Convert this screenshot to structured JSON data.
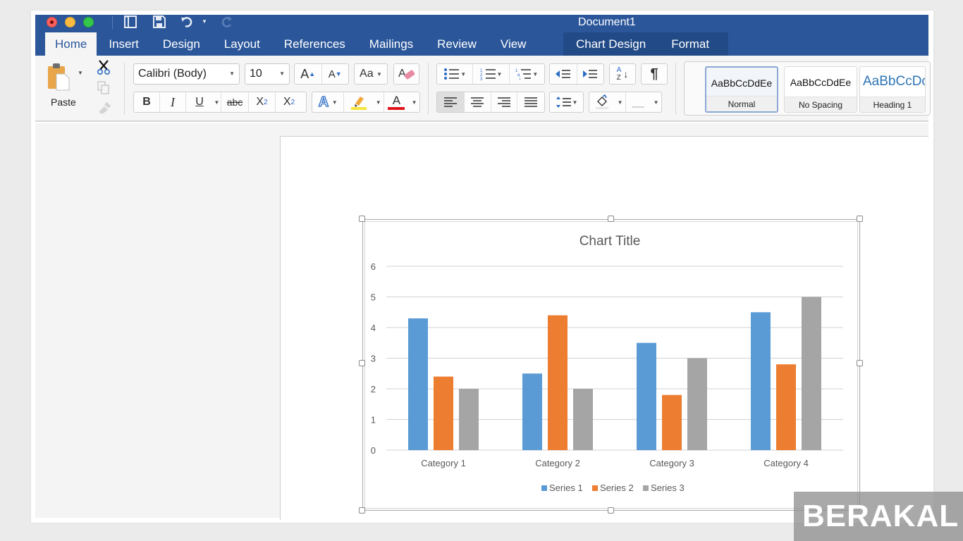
{
  "window": {
    "title": "Document1",
    "quick_access": [
      {
        "icon": "sidebar-icon"
      },
      {
        "icon": "save-icon"
      },
      {
        "icon": "undo-icon"
      },
      {
        "icon": "redo-icon"
      }
    ]
  },
  "tabs": [
    {
      "label": "Home",
      "active": true
    },
    {
      "label": "Insert"
    },
    {
      "label": "Design"
    },
    {
      "label": "Layout"
    },
    {
      "label": "References"
    },
    {
      "label": "Mailings"
    },
    {
      "label": "Review"
    },
    {
      "label": "View"
    }
  ],
  "context_tabs": [
    {
      "label": "Chart Design"
    },
    {
      "label": "Format"
    }
  ],
  "ribbon": {
    "paste_label": "Paste",
    "font_name": "Calibri (Body)",
    "font_size": "10",
    "glyphs": {
      "grow": "A",
      "shrink": "A",
      "change_case": "Aa",
      "bold": "B",
      "italic": "I",
      "underline": "U",
      "strike": "abc",
      "subscript": "X",
      "subscript_sub": "2",
      "superscript": "X",
      "superscript_sup": "2",
      "text_effects": "A",
      "font_color": "A",
      "pilcrow": "¶",
      "sort_a": "A",
      "sort_z": "Z"
    },
    "colors": {
      "highlight": "#f5e53b",
      "font_color": "#e0131b",
      "accent": "#2b579a"
    },
    "styles": [
      {
        "sample": "AaBbCcDdEe",
        "name": "Normal",
        "selected": true
      },
      {
        "sample": "AaBbCcDdEe",
        "name": "No Spacing"
      },
      {
        "sample": "AaBbCcDc",
        "name": "Heading 1"
      }
    ]
  },
  "chart_data": {
    "type": "bar",
    "title": "Chart Title",
    "categories": [
      "Category 1",
      "Category 2",
      "Category 3",
      "Category 4"
    ],
    "series": [
      {
        "name": "Series 1",
        "color": "#5b9bd5",
        "values": [
          4.3,
          2.5,
          3.5,
          4.5
        ]
      },
      {
        "name": "Series 2",
        "color": "#ed7d31",
        "values": [
          2.4,
          4.4,
          1.8,
          2.8
        ]
      },
      {
        "name": "Series 3",
        "color": "#a5a5a5",
        "values": [
          2,
          2,
          3,
          5
        ]
      }
    ],
    "ylim": [
      0,
      6
    ],
    "yticks": [
      "0",
      "1",
      "2",
      "3",
      "4",
      "5",
      "6"
    ],
    "xlabel": "",
    "ylabel": "",
    "grid": true,
    "legend": "bottom"
  },
  "watermark": "BERAKAL"
}
